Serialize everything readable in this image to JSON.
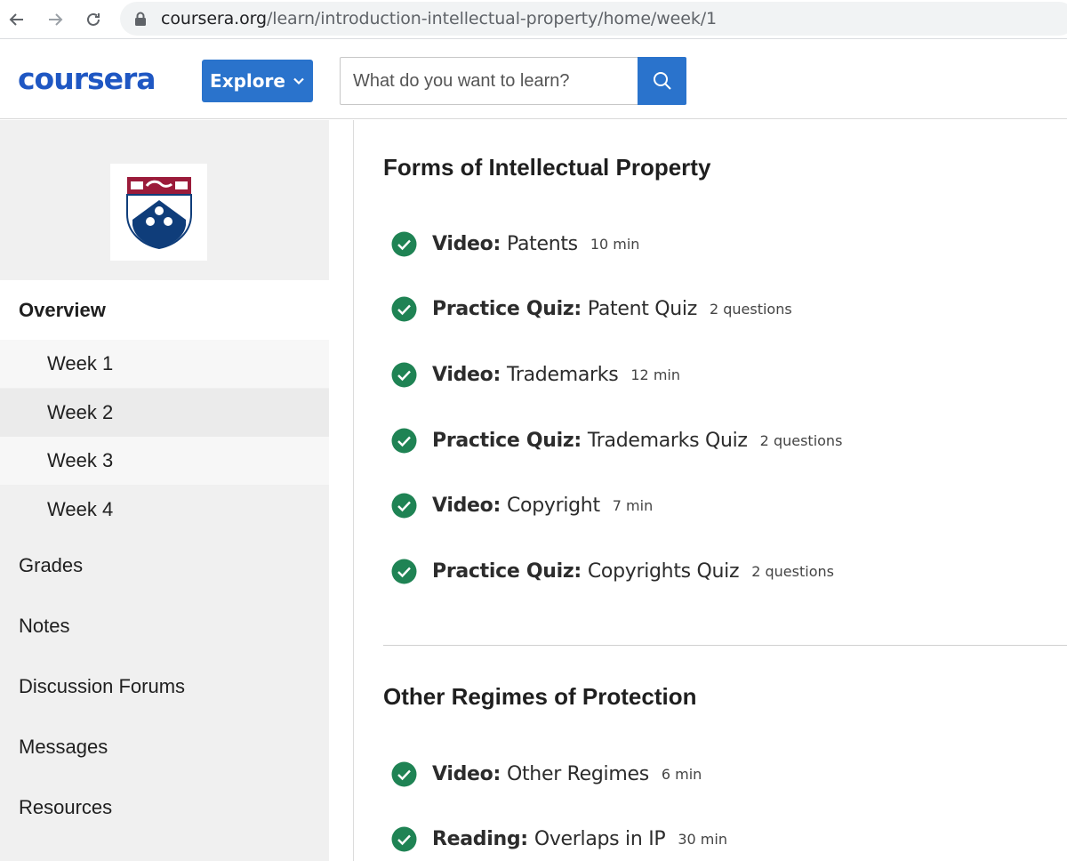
{
  "browser": {
    "url_domain": "coursera.org",
    "url_path": "/learn/introduction-intellectual-property/home/week/1"
  },
  "header": {
    "logo_text": "coursera",
    "explore_label": "Explore",
    "search_placeholder": "What do you want to learn?",
    "brand_color": "#2a73cc"
  },
  "sidebar": {
    "overview_label": "Overview",
    "weeks": [
      "Week 1",
      "Week 2",
      "Week 3",
      "Week 4"
    ],
    "links": [
      "Grades",
      "Notes",
      "Discussion Forums",
      "Messages",
      "Resources"
    ]
  },
  "main": {
    "sections": [
      {
        "title": "Forms of Intellectual Property",
        "items": [
          {
            "type": "Video:",
            "name": "Patents",
            "meta": "10 min",
            "completed": true
          },
          {
            "type": "Practice Quiz:",
            "name": "Patent Quiz",
            "meta": "2 questions",
            "completed": true
          },
          {
            "type": "Video:",
            "name": "Trademarks",
            "meta": "12 min",
            "completed": true
          },
          {
            "type": "Practice Quiz:",
            "name": "Trademarks Quiz",
            "meta": "2 questions",
            "completed": true
          },
          {
            "type": "Video:",
            "name": "Copyright",
            "meta": "7 min",
            "completed": true
          },
          {
            "type": "Practice Quiz:",
            "name": "Copyrights Quiz",
            "meta": "2 questions",
            "completed": true
          }
        ]
      },
      {
        "title": "Other Regimes of Protection",
        "items": [
          {
            "type": "Video:",
            "name": "Other Regimes",
            "meta": "6 min",
            "completed": true
          },
          {
            "type": "Reading:",
            "name": "Overlaps in IP",
            "meta": "30 min",
            "completed": true
          }
        ]
      }
    ],
    "check_color": "#1f8354"
  }
}
